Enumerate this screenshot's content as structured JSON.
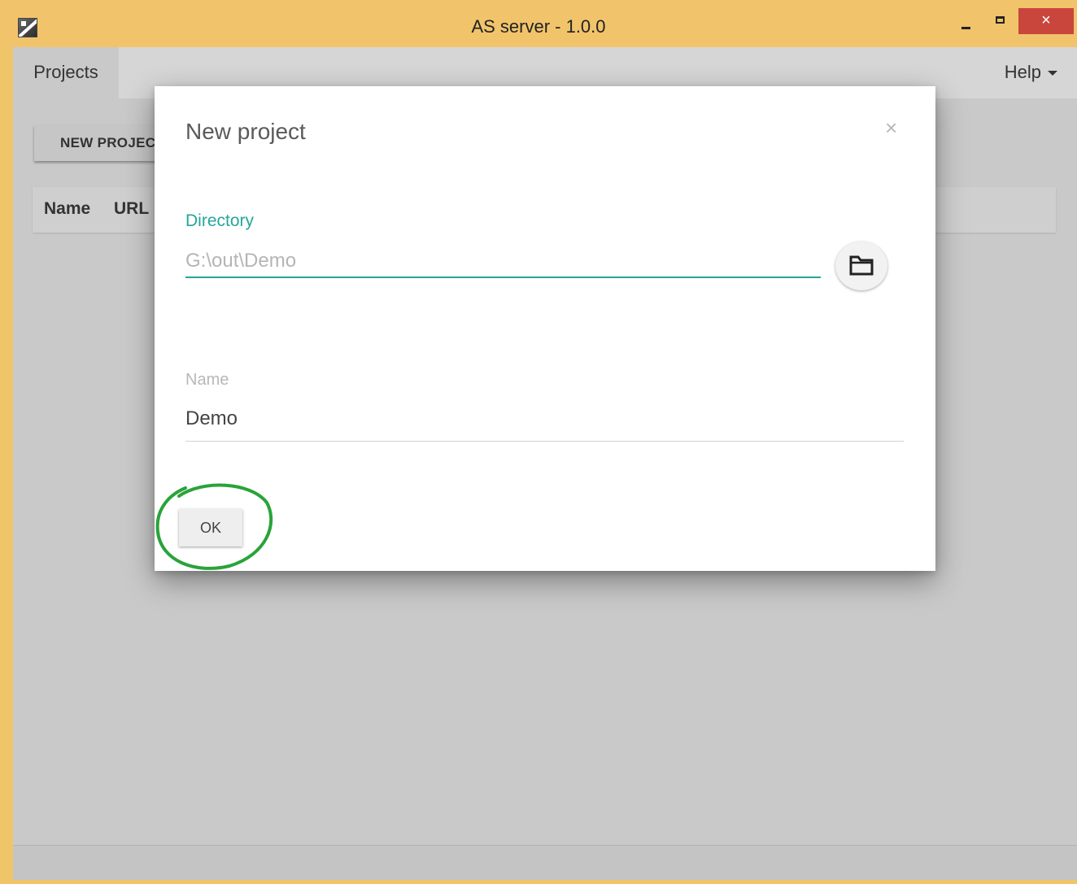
{
  "window": {
    "title": "AS server - 1.0.0",
    "close_glyph": "×"
  },
  "toolbar": {
    "tab_projects": "Projects",
    "help_menu": "Help",
    "new_project_label": "NEW PROJECT"
  },
  "table": {
    "columns": [
      "Name",
      "URL"
    ]
  },
  "dialog": {
    "title": "New project",
    "close_glyph": "×",
    "directory_label": "Directory",
    "directory_placeholder": "G:\\out\\Demo",
    "directory_value": "",
    "name_label": "Name",
    "name_value": "Demo",
    "ok_label": "OK"
  },
  "icons": {
    "app": "app-icon",
    "folder": "folder-icon"
  },
  "colors": {
    "titlebar": "#f1c46b",
    "close_button": "#c9463d",
    "accent_teal": "#26a69a",
    "highlight_circle": "#2aa33a",
    "overlay_background": "#c9c9c9"
  }
}
